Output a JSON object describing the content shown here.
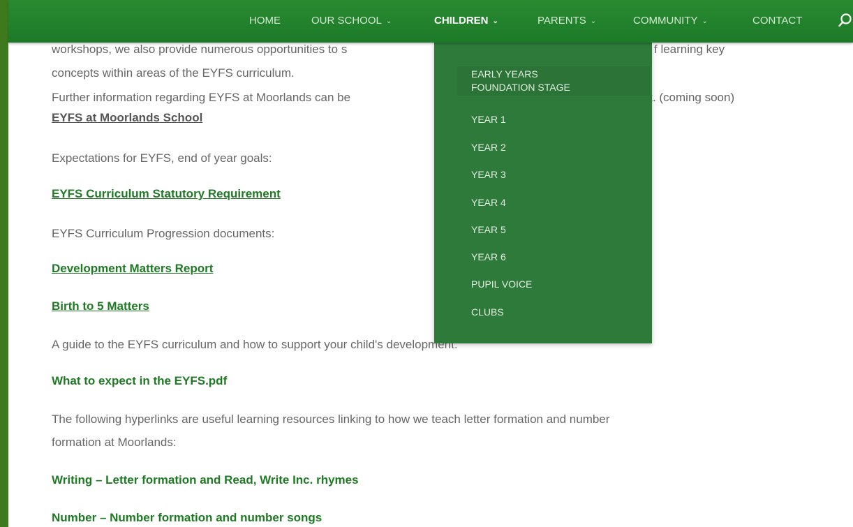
{
  "nav": {
    "items": [
      {
        "label": "HOME"
      },
      {
        "label": "OUR SCHOOL"
      },
      {
        "label": "CHILDREN"
      },
      {
        "label": "PARENTS"
      },
      {
        "label": "COMMUNITY"
      },
      {
        "label": "CONTACT"
      }
    ],
    "chevron": "⌄",
    "search_icon": "search-icon"
  },
  "dropdown": {
    "items": [
      {
        "label": "EARLY YEARS FOUNDATION STAGE"
      },
      {
        "label": "YEAR 1"
      },
      {
        "label": "YEAR 2"
      },
      {
        "label": "YEAR 3"
      },
      {
        "label": "YEAR 4"
      },
      {
        "label": "YEAR 5"
      },
      {
        "label": "YEAR 6"
      },
      {
        "label": "PUPIL VOICE"
      },
      {
        "label": "CLUBS"
      }
    ],
    "first_line1": "EARLY YEARS",
    "first_line2": "FOUNDATION STAGE"
  },
  "content": {
    "intro_line1_left": "workshops, we also provide numerous opportunities to s",
    "intro_line1_right": "f learning key",
    "intro_line2": "concepts within areas of the EYFS curriculum.",
    "intro_line3_left": "Further information regarding EYFS at Moorlands can be",
    "intro_line3_right": "nk. (coming soon)",
    "eyfs_link": "EYFS at Moorlands School ",
    "expectations": "Expectations for EYFS, end of year goals:",
    "statutory_link": "EYFS Curriculum Statutory Requirement",
    "progression": "EYFS Curriculum Progression documents:",
    "dev_matters_link": "Development Matters Report",
    "birth_link": "Birth to 5 Matters",
    "guide": "A guide to the EYFS curriculum and how to support your child's development.",
    "expect_link": "What to expect in the EYFS.pdf",
    "hyperlinks_line1": "The following hyperlinks are useful learning resources linking to how we teach letter formation and number",
    "hyperlinks_line2": "formation at Moorlands:",
    "writing_link": "Writing – Letter formation and Read, Write Inc. rhymes",
    "number_link": "Number – Number formation and number songs"
  },
  "colors": {
    "nav_bg": "#1c7a28",
    "dropdown_bg": "#2e7a3b",
    "link_green": "#1f7a24",
    "body_text": "#666666",
    "frame": "#3e7a1d"
  }
}
